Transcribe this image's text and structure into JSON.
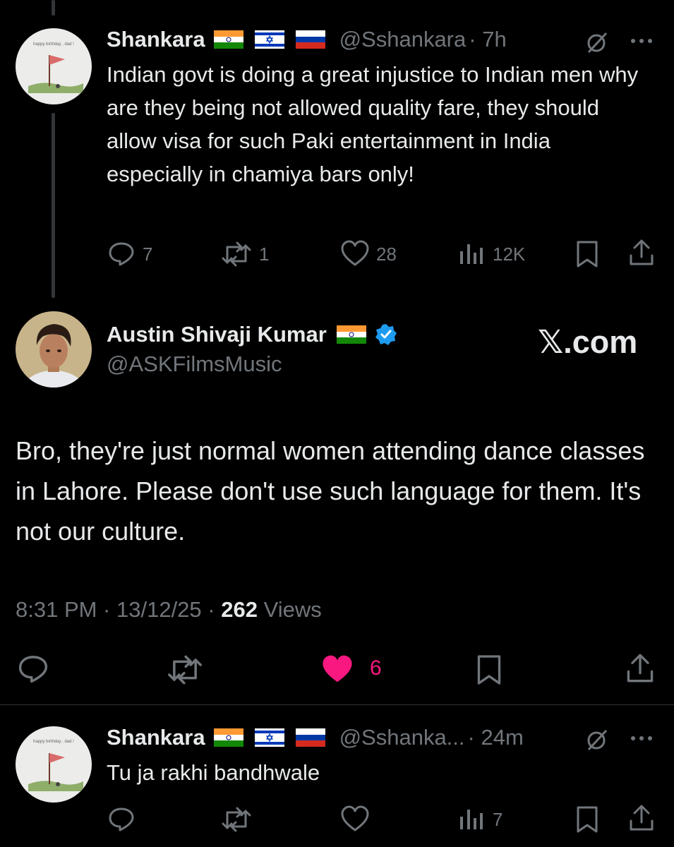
{
  "tweet1": {
    "name": "Shankara",
    "handle": "@Sshankara",
    "time": "· 7h",
    "text": "Indian govt is doing a great injustice to Indian men why are they being not allowed quality fare, they should allow visa for such Paki entertainment in India especially in chamiya bars only!",
    "avatar_caption": "happy birthday , dad !",
    "actions": {
      "replies": "7",
      "reposts": "1",
      "likes": "28",
      "views": "12K"
    }
  },
  "main": {
    "name": "Austin Shivaji Kumar",
    "handle": "@ASKFilmsMusic",
    "watermark": "𝕏.com",
    "text": "Bro, they're just normal women attending dance classes in Lahore. Please don't use such language for them. It's not our culture.",
    "timestamp": "8:31 PM · 13/12/25 ·",
    "views_count": "262",
    "views_label": "Views",
    "likes": "6"
  },
  "reply": {
    "name": "Shankara",
    "handle": "@Sshanka...",
    "time": "· 24m",
    "text": "Tu ja rakhi bandhwale",
    "avatar_caption": "happy birthday , dad !",
    "actions": {
      "views": "7"
    }
  },
  "colors": {
    "like_active": "#f91880",
    "verified": "#1d9bf0",
    "muted": "#71767b"
  }
}
